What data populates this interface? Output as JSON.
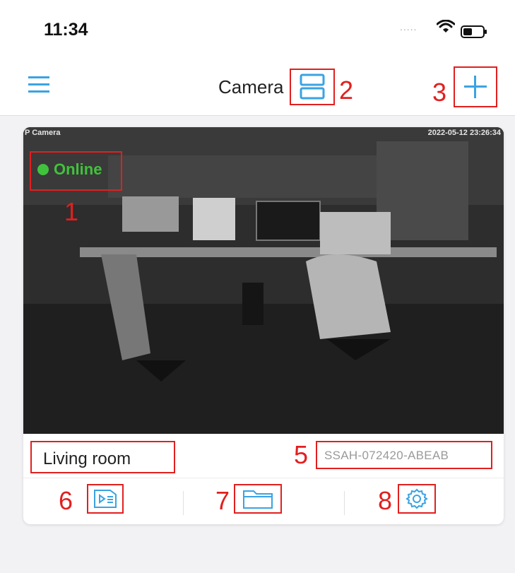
{
  "status_bar": {
    "time": "11:34",
    "signal": ".....",
    "icons": [
      "wifi-icon",
      "battery-icon"
    ]
  },
  "nav": {
    "title": "Camera",
    "icons": [
      "menu-icon",
      "layout-toggle-icon",
      "add-icon"
    ],
    "accent_color": "#3aa3e3"
  },
  "markers": [
    "1",
    "2",
    "3",
    "5",
    "6",
    "7",
    "8"
  ],
  "camera": {
    "osd_label": "P Camera",
    "osd_timestamp": "2022-05-12 23:26:34",
    "status": "Online",
    "status_color": "#41c23c",
    "name": "Living room",
    "serial": "SSAH-072420-ABEAB"
  },
  "actions": [
    {
      "icon": "playback-icon"
    },
    {
      "icon": "folder-icon"
    },
    {
      "icon": "gear-icon"
    }
  ],
  "highlight_color": "#e0201f"
}
